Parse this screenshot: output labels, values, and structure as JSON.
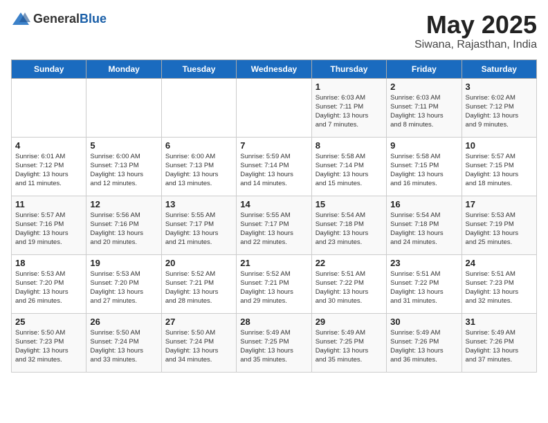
{
  "header": {
    "logo_general": "General",
    "logo_blue": "Blue",
    "month": "May 2025",
    "location": "Siwana, Rajasthan, India"
  },
  "days_of_week": [
    "Sunday",
    "Monday",
    "Tuesday",
    "Wednesday",
    "Thursday",
    "Friday",
    "Saturday"
  ],
  "weeks": [
    [
      {
        "day": "",
        "info": ""
      },
      {
        "day": "",
        "info": ""
      },
      {
        "day": "",
        "info": ""
      },
      {
        "day": "",
        "info": ""
      },
      {
        "day": "1",
        "info": "Sunrise: 6:03 AM\nSunset: 7:11 PM\nDaylight: 13 hours\nand 7 minutes."
      },
      {
        "day": "2",
        "info": "Sunrise: 6:03 AM\nSunset: 7:11 PM\nDaylight: 13 hours\nand 8 minutes."
      },
      {
        "day": "3",
        "info": "Sunrise: 6:02 AM\nSunset: 7:12 PM\nDaylight: 13 hours\nand 9 minutes."
      }
    ],
    [
      {
        "day": "4",
        "info": "Sunrise: 6:01 AM\nSunset: 7:12 PM\nDaylight: 13 hours\nand 11 minutes."
      },
      {
        "day": "5",
        "info": "Sunrise: 6:00 AM\nSunset: 7:13 PM\nDaylight: 13 hours\nand 12 minutes."
      },
      {
        "day": "6",
        "info": "Sunrise: 6:00 AM\nSunset: 7:13 PM\nDaylight: 13 hours\nand 13 minutes."
      },
      {
        "day": "7",
        "info": "Sunrise: 5:59 AM\nSunset: 7:14 PM\nDaylight: 13 hours\nand 14 minutes."
      },
      {
        "day": "8",
        "info": "Sunrise: 5:58 AM\nSunset: 7:14 PM\nDaylight: 13 hours\nand 15 minutes."
      },
      {
        "day": "9",
        "info": "Sunrise: 5:58 AM\nSunset: 7:15 PM\nDaylight: 13 hours\nand 16 minutes."
      },
      {
        "day": "10",
        "info": "Sunrise: 5:57 AM\nSunset: 7:15 PM\nDaylight: 13 hours\nand 18 minutes."
      }
    ],
    [
      {
        "day": "11",
        "info": "Sunrise: 5:57 AM\nSunset: 7:16 PM\nDaylight: 13 hours\nand 19 minutes."
      },
      {
        "day": "12",
        "info": "Sunrise: 5:56 AM\nSunset: 7:16 PM\nDaylight: 13 hours\nand 20 minutes."
      },
      {
        "day": "13",
        "info": "Sunrise: 5:55 AM\nSunset: 7:17 PM\nDaylight: 13 hours\nand 21 minutes."
      },
      {
        "day": "14",
        "info": "Sunrise: 5:55 AM\nSunset: 7:17 PM\nDaylight: 13 hours\nand 22 minutes."
      },
      {
        "day": "15",
        "info": "Sunrise: 5:54 AM\nSunset: 7:18 PM\nDaylight: 13 hours\nand 23 minutes."
      },
      {
        "day": "16",
        "info": "Sunrise: 5:54 AM\nSunset: 7:18 PM\nDaylight: 13 hours\nand 24 minutes."
      },
      {
        "day": "17",
        "info": "Sunrise: 5:53 AM\nSunset: 7:19 PM\nDaylight: 13 hours\nand 25 minutes."
      }
    ],
    [
      {
        "day": "18",
        "info": "Sunrise: 5:53 AM\nSunset: 7:20 PM\nDaylight: 13 hours\nand 26 minutes."
      },
      {
        "day": "19",
        "info": "Sunrise: 5:53 AM\nSunset: 7:20 PM\nDaylight: 13 hours\nand 27 minutes."
      },
      {
        "day": "20",
        "info": "Sunrise: 5:52 AM\nSunset: 7:21 PM\nDaylight: 13 hours\nand 28 minutes."
      },
      {
        "day": "21",
        "info": "Sunrise: 5:52 AM\nSunset: 7:21 PM\nDaylight: 13 hours\nand 29 minutes."
      },
      {
        "day": "22",
        "info": "Sunrise: 5:51 AM\nSunset: 7:22 PM\nDaylight: 13 hours\nand 30 minutes."
      },
      {
        "day": "23",
        "info": "Sunrise: 5:51 AM\nSunset: 7:22 PM\nDaylight: 13 hours\nand 31 minutes."
      },
      {
        "day": "24",
        "info": "Sunrise: 5:51 AM\nSunset: 7:23 PM\nDaylight: 13 hours\nand 32 minutes."
      }
    ],
    [
      {
        "day": "25",
        "info": "Sunrise: 5:50 AM\nSunset: 7:23 PM\nDaylight: 13 hours\nand 32 minutes."
      },
      {
        "day": "26",
        "info": "Sunrise: 5:50 AM\nSunset: 7:24 PM\nDaylight: 13 hours\nand 33 minutes."
      },
      {
        "day": "27",
        "info": "Sunrise: 5:50 AM\nSunset: 7:24 PM\nDaylight: 13 hours\nand 34 minutes."
      },
      {
        "day": "28",
        "info": "Sunrise: 5:49 AM\nSunset: 7:25 PM\nDaylight: 13 hours\nand 35 minutes."
      },
      {
        "day": "29",
        "info": "Sunrise: 5:49 AM\nSunset: 7:25 PM\nDaylight: 13 hours\nand 35 minutes."
      },
      {
        "day": "30",
        "info": "Sunrise: 5:49 AM\nSunset: 7:26 PM\nDaylight: 13 hours\nand 36 minutes."
      },
      {
        "day": "31",
        "info": "Sunrise: 5:49 AM\nSunset: 7:26 PM\nDaylight: 13 hours\nand 37 minutes."
      }
    ]
  ]
}
